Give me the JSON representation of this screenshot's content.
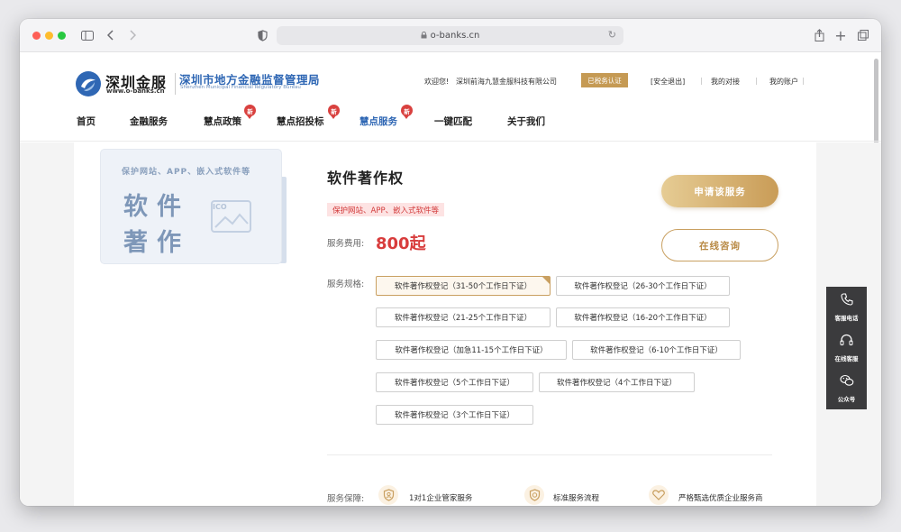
{
  "browser": {
    "url": "o-banks.cn"
  },
  "brand": {
    "logo_name": "深圳金服",
    "logo_url": "www.o-banks.cn",
    "bureau_cn": "深圳市地方金融监督管理局",
    "bureau_en": "Shenzhen Municipal Financial Regulatory Bureau"
  },
  "topbar": {
    "welcome": "欢迎您!",
    "company": "深圳前海九慧金服科技有限公司",
    "verified": "已税务认证",
    "logout": "[安全退出]",
    "my_connect": "我的对接",
    "my_account": "我的账户"
  },
  "nav": {
    "items": [
      {
        "label": "首页",
        "new": false,
        "active": false
      },
      {
        "label": "金融服务",
        "new": false,
        "active": false
      },
      {
        "label": "慧点政策",
        "new": true,
        "active": false
      },
      {
        "label": "慧点招投标",
        "new": true,
        "active": false
      },
      {
        "label": "慧点服务",
        "new": true,
        "active": true
      },
      {
        "label": "一键匹配",
        "new": false,
        "active": false
      },
      {
        "label": "关于我们",
        "new": false,
        "active": false
      }
    ],
    "new_badge": "新"
  },
  "product": {
    "image": {
      "subtitle": "保护网站、APP、嵌入式软件等",
      "big_chars": [
        "软",
        "件",
        "著",
        "作"
      ],
      "placeholder": "ICO"
    },
    "title": "软件著作权",
    "tag": "保护网站、APP、嵌入式软件等",
    "fee_label": "服务费用:",
    "fee_value": "800起",
    "apply_button": "申请该服务",
    "consult_button": "在线咨询",
    "spec_label": "服务规格:",
    "specs": [
      "软件著作权登记（31-50个工作日下证）",
      "软件著作权登记（26-30个工作日下证）",
      "软件著作权登记（21-25个工作日下证）",
      "软件著作权登记（16-20个工作日下证）",
      "软件著作权登记（加急11-15个工作日下证）",
      "软件著作权登记（6-10个工作日下证）",
      "软件著作权登记（5个工作日下证）",
      "软件著作权登记（4个工作日下证）",
      "软件著作权登记（3个工作日下证）"
    ],
    "selected_spec_index": 0
  },
  "guarantee": {
    "label": "服务保障:",
    "items": [
      {
        "icon": "shield-person-icon",
        "text": "1对1企业管家服务"
      },
      {
        "icon": "shield-check-icon",
        "text": "标准服务流程"
      },
      {
        "icon": "heart-icon",
        "text": "严格甄选优质企业服务商"
      }
    ]
  },
  "float_panel": {
    "items": [
      {
        "icon": "phone-icon",
        "label": "客服电话"
      },
      {
        "icon": "headset-icon",
        "label": "在线客服"
      },
      {
        "icon": "wechat-icon",
        "label": "公众号"
      }
    ]
  },
  "colors": {
    "accent_blue": "#2f67b4",
    "gold": "#c9a061",
    "price_red": "#d83c3c"
  }
}
